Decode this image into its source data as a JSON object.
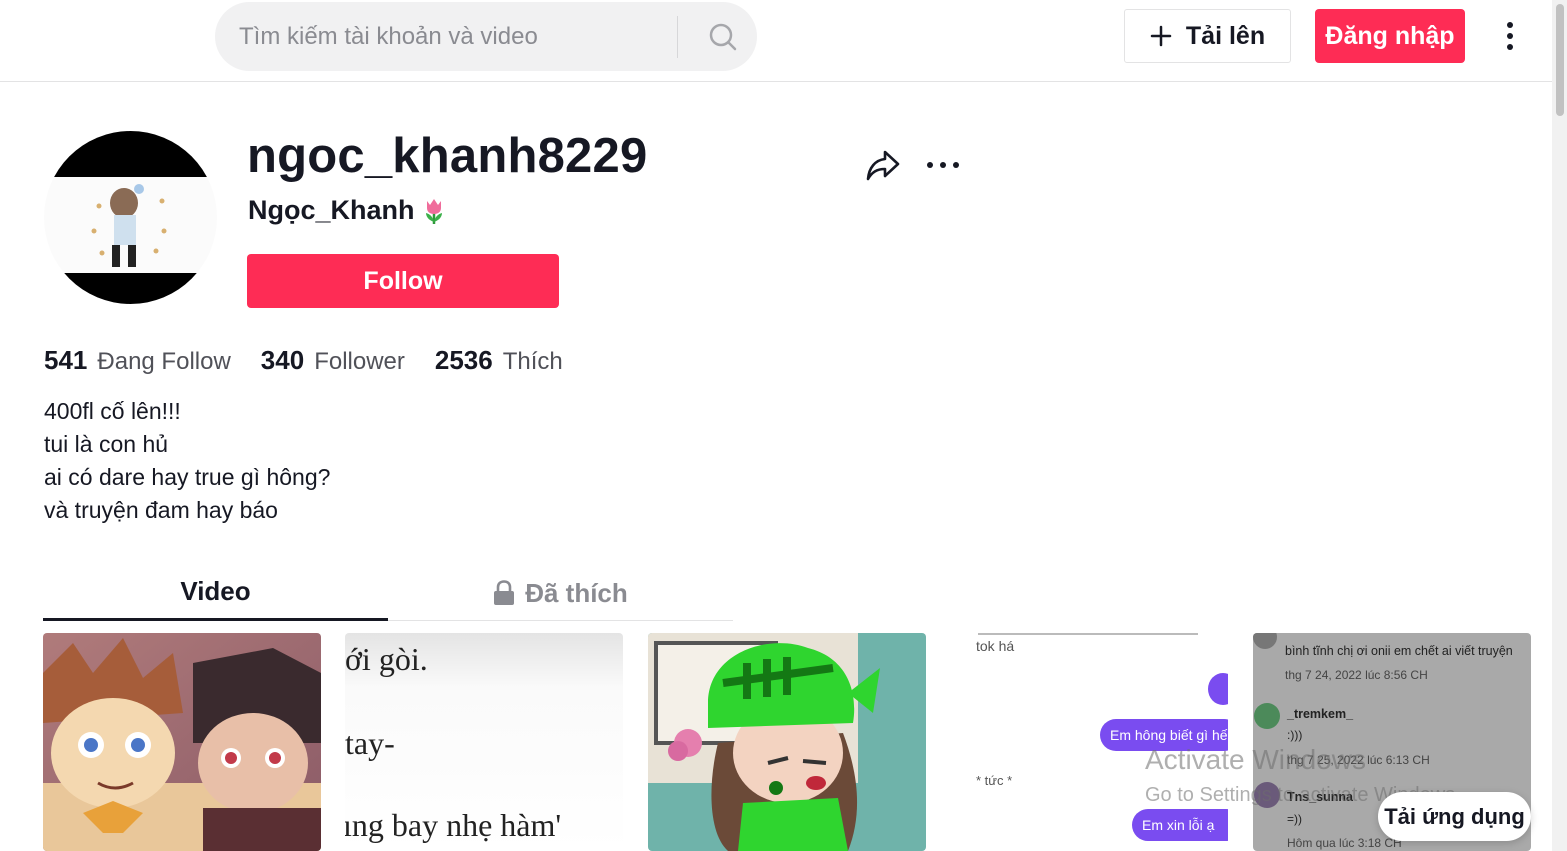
{
  "header": {
    "search_placeholder": "Tìm kiếm tài khoản và video",
    "upload_label": "Tải lên",
    "login_label": "Đăng nhập"
  },
  "profile": {
    "username": "ngoc_khanh8229",
    "nickname": "Ngọc_Khanh",
    "nickname_emoji": "tulip",
    "follow_label": "Follow",
    "stats": [
      {
        "value": "541",
        "label": "Đang Follow"
      },
      {
        "value": "340",
        "label": "Follower"
      },
      {
        "value": "2536",
        "label": "Thích"
      }
    ],
    "bio": [
      "400fl cố lên!!!",
      "tui là con hủ",
      "ai có dare hay true gì hông?",
      "và truyện đam hay báo"
    ]
  },
  "tabs": [
    {
      "label": "Video",
      "active": true
    },
    {
      "label": "Đã thích",
      "active": false,
      "icon": "lock-icon"
    }
  ],
  "videos": [
    {
      "kind": "anime-art"
    },
    {
      "kind": "text",
      "lines": [
        "ới gòi.",
        "tay-",
        "ıng bay nhẹ hàm'"
      ]
    },
    {
      "kind": "gacha-art"
    },
    {
      "kind": "chat",
      "lines": [
        "tok há",
        "Em hông biết gì hế",
        "* tức *",
        "Em xin lỗi ạ"
      ]
    },
    {
      "kind": "comments",
      "lines": [
        "bình tĩnh chị ơi onii em chết ai viết truyện",
        "thg 7 24, 2022 lúc 8:56 CH",
        "_tremkem_",
        ":)))",
        "thg 7 25, 2022 lúc 6:13 CH",
        "Tns_sunna",
        "=))",
        "Hôm qua lúc 3:18 CH"
      ]
    }
  ],
  "watermark": {
    "title": "Activate Windows",
    "subtitle": "Go to Settings to activate Windows."
  },
  "app_button_label": "Tải ứng dụng",
  "colors": {
    "brand": "#fe2c55",
    "text": "#161823",
    "muted": "#8a8b91"
  }
}
